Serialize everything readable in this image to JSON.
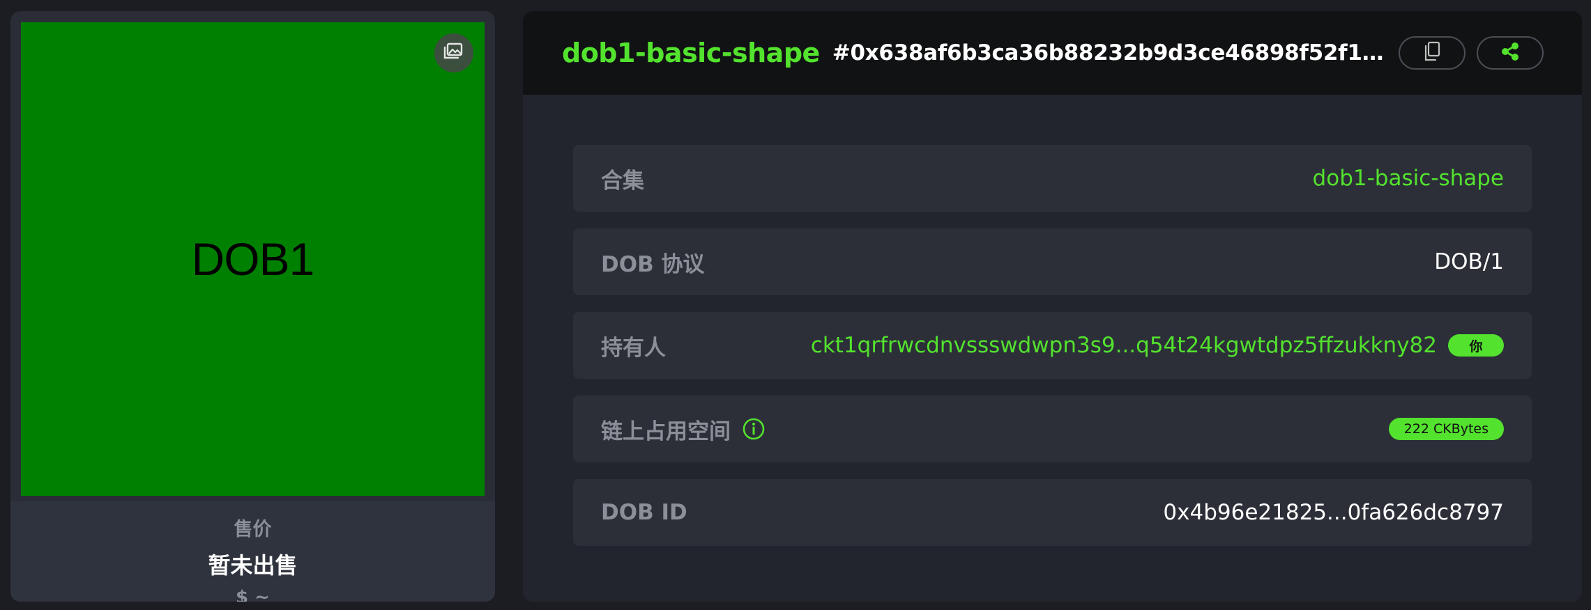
{
  "preview": {
    "text": "DOB1",
    "background": "#008000",
    "gallery_icon": "gallery-icon"
  },
  "price": {
    "label": "售价",
    "value": "暂未出售",
    "usd": "$ ~"
  },
  "header": {
    "collection_name": "dob1-basic-shape",
    "dob_id": "#0x638af6b3ca36b88232b9d3ce46898f52f10b23...",
    "copy_icon": "copy-icon",
    "share_icon": "share-icon"
  },
  "details": {
    "collection": {
      "label": "合集",
      "value": "dob1-basic-shape"
    },
    "protocol": {
      "label": "DOB 协议",
      "value": "DOB/1"
    },
    "owner": {
      "label": "持有人",
      "value": "ckt1qrfrwcdnvssswdwpn3s9...q54t24kgwtdpz5ffzukkny82",
      "badge": "你"
    },
    "storage": {
      "label": "链上占用空间",
      "info_icon": "info-icon",
      "badge": "222 CKBytes"
    },
    "dob_id": {
      "label": "DOB ID",
      "value": "0x4b96e21825...0fa626dc8797"
    }
  },
  "colors": {
    "accent": "#53e22e",
    "page_bg": "#1b1d23",
    "card_bg": "#22252d",
    "row_bg": "#2c2f38",
    "header_bg": "#111213"
  }
}
